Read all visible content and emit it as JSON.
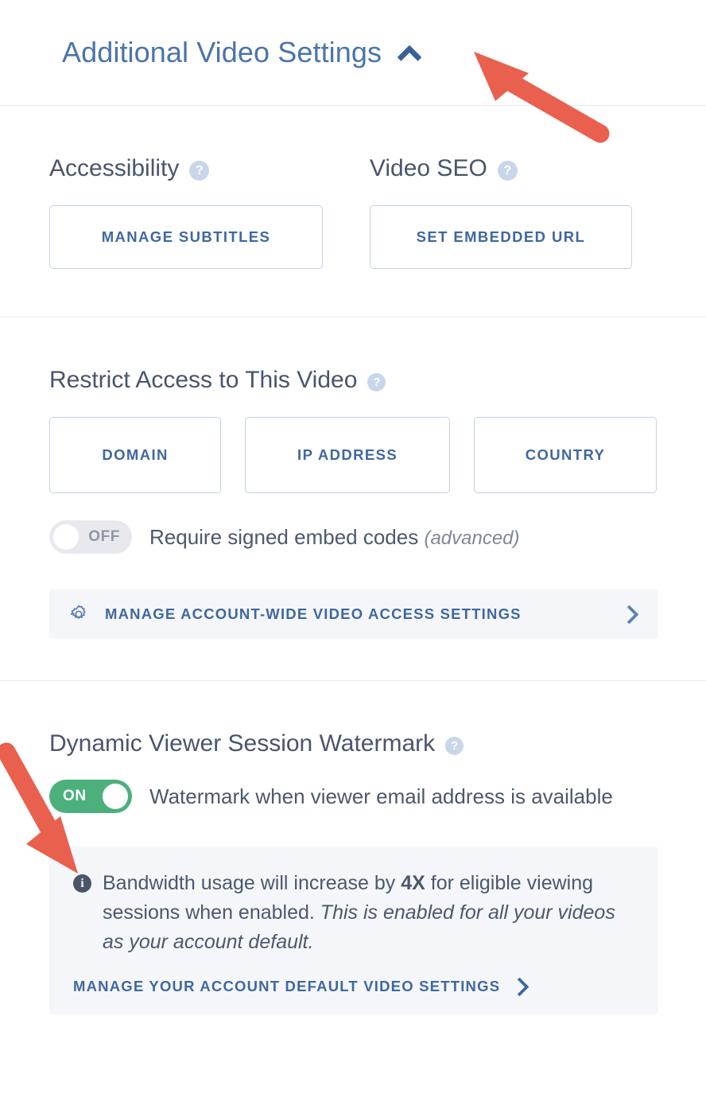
{
  "panel": {
    "title": "Additional Video Settings",
    "collapse_icon": "chevron-up-icon"
  },
  "accessibility": {
    "heading": "Accessibility",
    "help_icon": "help-circle-icon",
    "button_label": "MANAGE SUBTITLES"
  },
  "video_seo": {
    "heading": "Video SEO",
    "help_icon": "help-circle-icon",
    "button_label": "SET EMBEDDED URL"
  },
  "restrict_access": {
    "heading": "Restrict Access to This Video",
    "help_icon": "help-circle-icon",
    "buttons": [
      {
        "label": "DOMAIN"
      },
      {
        "label": "IP ADDRESS"
      },
      {
        "label": "COUNTRY"
      }
    ],
    "signed_embed": {
      "toggle_state": "OFF",
      "label": "Require signed embed codes",
      "label_suffix": "(advanced)"
    },
    "account_wide_link": {
      "icon": "gear-icon",
      "label": "MANAGE ACCOUNT-WIDE VIDEO ACCESS SETTINGS",
      "chevron": "chevron-right-icon"
    }
  },
  "watermark": {
    "heading": "Dynamic Viewer Session Watermark",
    "help_icon": "help-circle-icon",
    "toggle_state": "ON",
    "toggle_label": "Watermark when viewer email address is available",
    "info": {
      "icon": "info-circle-icon",
      "text_part_1": "Bandwidth usage will increase by ",
      "text_bold": "4X",
      "text_part_2": " for eligible viewing sessions when enabled. ",
      "text_italic": "This is enabled for all your videos as your account default.",
      "cta_label": "MANAGE YOUR ACCOUNT DEFAULT VIDEO SETTINGS",
      "cta_chevron": "chevron-right-icon"
    }
  },
  "annotations": {
    "arrow_color": "#e9604e",
    "arrows": [
      {
        "name": "arrow-to-collapse-chevron",
        "points_to": "chevron-up-icon"
      },
      {
        "name": "arrow-to-watermark-toggle",
        "points_to": "watermark-toggle"
      }
    ]
  },
  "colors": {
    "link_blue": "#3f689f",
    "heading_slate": "#49556b",
    "toggle_on_green": "#4cb07c",
    "toggle_off_gray": "#e7e9ee",
    "help_icon_blue": "#c9d5e9",
    "panel_bg": "#f4f6fa",
    "divider": "#e7e9ee",
    "annotation_red": "#e9604e"
  }
}
